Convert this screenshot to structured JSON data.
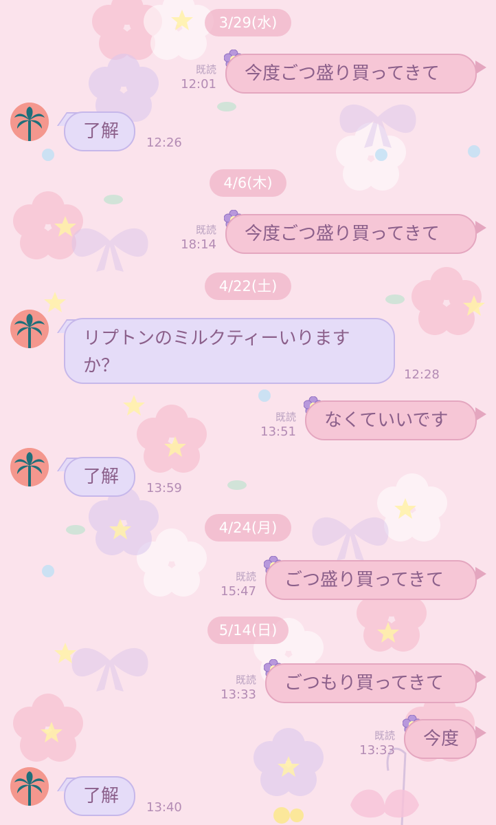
{
  "chat": {
    "dates": [
      "3/29(水)",
      "4/6(木)",
      "4/22(土)",
      "4/24(月)",
      "5/14(日)"
    ],
    "read_label": "既読",
    "messages": [
      {
        "side": "out",
        "text": "今度ごつ盛り買ってきて",
        "time": "12:01",
        "read": true
      },
      {
        "side": "in",
        "text": "了解",
        "time": "12:26"
      },
      {
        "side": "out",
        "text": "今度ごつ盛り買ってきて",
        "time": "18:14",
        "read": true
      },
      {
        "side": "in",
        "text": "リプトンのミルクティーいりますか？",
        "time": "12:28"
      },
      {
        "side": "out",
        "text": "なくていいです",
        "time": "13:51",
        "read": true
      },
      {
        "side": "in",
        "text": "了解",
        "time": "13:59"
      },
      {
        "side": "out",
        "text": "ごつ盛り買ってきて",
        "time": "15:47",
        "read": true
      },
      {
        "side": "out",
        "text": "ごつもり買ってきて",
        "time": "13:33",
        "read": true
      },
      {
        "side": "out",
        "text": "今度",
        "time": "13:33",
        "read": true
      },
      {
        "side": "in",
        "text": "了解",
        "time": "13:40"
      }
    ]
  },
  "colors": {
    "background": "#fbe3ec",
    "outgoing_bubble": "#f6c6d6",
    "incoming_bubble": "#e5dcf8",
    "text": "#8b5f8a",
    "avatar": "#f4978e",
    "palm": "#1f6f7a"
  },
  "icons": {
    "avatar": "palm-tree-icon",
    "badge": "flower-icon"
  }
}
